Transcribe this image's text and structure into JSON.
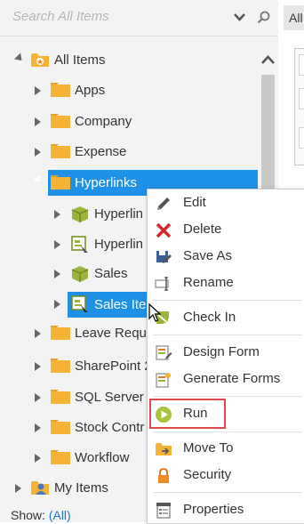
{
  "search": {
    "placeholder": "Search All Items"
  },
  "tree": {
    "items": [
      {
        "label": "All Items"
      },
      {
        "label": "Apps"
      },
      {
        "label": "Company"
      },
      {
        "label": "Expense"
      },
      {
        "label": "Hyperlinks"
      },
      {
        "label": "Hyperlin"
      },
      {
        "label": "Hyperlin"
      },
      {
        "label": "Sales"
      },
      {
        "label": "Sales Ite"
      },
      {
        "label": "Leave Reque"
      },
      {
        "label": "SharePoint 2"
      },
      {
        "label": "SQL Server"
      },
      {
        "label": "Stock Contr"
      },
      {
        "label": "Workflow"
      },
      {
        "label": "My Items"
      }
    ]
  },
  "footer": {
    "show_label": "Show:",
    "show_value": "(All)"
  },
  "right_panel": {
    "tab_label": "All"
  },
  "context_menu": {
    "items": [
      {
        "label": "Edit"
      },
      {
        "label": "Delete"
      },
      {
        "label": "Save As"
      },
      {
        "label": "Rename"
      },
      {
        "label": "Check In"
      },
      {
        "label": "Design Form"
      },
      {
        "label": "Generate Forms"
      },
      {
        "label": "Run"
      },
      {
        "label": "Move To"
      },
      {
        "label": "Security"
      },
      {
        "label": "Properties"
      }
    ]
  },
  "colors": {
    "selection": "#1e90e6",
    "highlight": "#e0474c",
    "folder": "#f5b335"
  }
}
